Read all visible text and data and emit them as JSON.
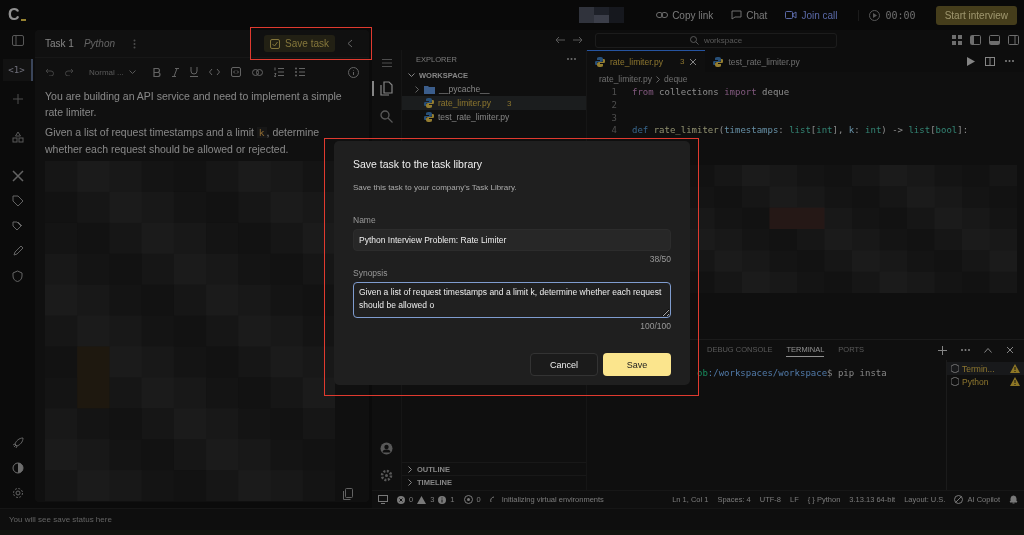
{
  "topbar": {
    "logo": "C",
    "links": [
      {
        "label": "Copy link",
        "kind": "link"
      },
      {
        "label": "Chat",
        "kind": "chat"
      },
      {
        "label": "Join call",
        "kind": "video"
      }
    ],
    "timer": "00:00",
    "start_button": "Start interview"
  },
  "rail": {
    "tab": {
      "label": "<1>",
      "selected": true
    }
  },
  "task": {
    "title": "Task 1",
    "language": "Python",
    "save_button": "Save task",
    "format_select": "Normal ...",
    "paragraphs": [
      [
        {
          "text": "You are building an API service and need to implement a simple rate limiter.",
          "kind": "plain"
        }
      ],
      [
        {
          "text": "Given a list of request timestamps and a limit ",
          "kind": "plain"
        },
        {
          "text": "k",
          "kind": "code"
        },
        {
          "text": ", determine whether each request should be allowed or rejected.",
          "kind": "plain"
        }
      ]
    ]
  },
  "ide": {
    "search": "workspace",
    "explorer": {
      "title": "EXPLORER",
      "section": "WORKSPACE",
      "items": [
        {
          "name": "__pycache__",
          "kind": "folder",
          "selected": false
        },
        {
          "name": "rate_limiter.py",
          "kind": "file",
          "badge": "3",
          "selected": true
        },
        {
          "name": "test_rate_limiter.py",
          "kind": "file",
          "selected": false
        }
      ],
      "sections": [
        "OUTLINE",
        "TIMELINE"
      ]
    },
    "tabs": [
      {
        "label": "rate_limiter.py",
        "badge": "3",
        "selected": true
      },
      {
        "label": "test_rate_limiter.py",
        "selected": false
      }
    ],
    "breadcrumb": [
      "rate_limiter.py",
      "deque"
    ],
    "code": [
      {
        "n": "1",
        "tokens": [
          {
            "text": "from",
            "kind": "kw"
          },
          {
            "text": " collections ",
            "kind": "plain"
          },
          {
            "text": "import",
            "kind": "kw"
          },
          {
            "text": " deque",
            "kind": "plain"
          }
        ]
      },
      {
        "n": "2"
      },
      {
        "n": "3"
      },
      {
        "n": "4",
        "tokens": [
          {
            "text": "def ",
            "kind": "def"
          },
          {
            "text": "rate_limiter",
            "kind": "fn"
          },
          {
            "text": "(",
            "kind": "plain"
          },
          {
            "text": "timestamps",
            "kind": "param"
          },
          {
            "text": ": ",
            "kind": "plain"
          },
          {
            "text": "list",
            "kind": "type"
          },
          {
            "text": "[",
            "kind": "plain"
          },
          {
            "text": "int",
            "kind": "type"
          },
          {
            "text": "], ",
            "kind": "plain"
          },
          {
            "text": "k",
            "kind": "param"
          },
          {
            "text": ": ",
            "kind": "plain"
          },
          {
            "text": "int",
            "kind": "type"
          },
          {
            "text": ") -> ",
            "kind": "plain"
          },
          {
            "text": "list",
            "kind": "type"
          },
          {
            "text": "[",
            "kind": "plain"
          },
          {
            "text": "bool",
            "kind": "type"
          },
          {
            "text": "]:",
            "kind": "plain"
          }
        ]
      }
    ],
    "panel_tabs": [
      {
        "label": "DEBUG CONSOLE",
        "selected": false
      },
      {
        "label": "TERMINAL",
        "selected": true
      },
      {
        "label": "PORTS",
        "selected": false
      }
    ],
    "terminal": [
      {
        "text": "ob",
        "kind": "user"
      },
      {
        "text": ":/workspaces/workspace",
        "kind": "path"
      },
      {
        "text": "$ pip insta",
        "kind": "plain"
      }
    ],
    "terminals": [
      {
        "label": "Termin...",
        "selected": true
      },
      {
        "label": "Python",
        "selected": false
      }
    ],
    "status": {
      "errors": "0",
      "warnings": "3",
      "infos": "1",
      "ports": "0",
      "message": "Initializing virtual environments",
      "right": [
        "Ln 1, Col 1",
        "Spaces: 4",
        "UTF-8",
        "LF",
        "{ } Python",
        "3.13.13 64-bit",
        "Layout: U.S."
      ],
      "copilot": "AI Copilot"
    }
  },
  "dialog": {
    "title": "Save task to the task library",
    "subtitle": "Save this task to your company's Task Library.",
    "fields": [
      {
        "label": "Name",
        "value": "Python Interview Problem: Rate Limiter",
        "count": "38/50",
        "kind": "input",
        "focused": false
      },
      {
        "label": "Synopsis",
        "value": "Given a list of request timestamps and a limit k, determine whether each request should be allowed o",
        "count": "100/100",
        "kind": "textarea",
        "focused": true
      }
    ],
    "cancel": "Cancel",
    "save": "Save"
  },
  "save_status": "You will see save status here"
}
